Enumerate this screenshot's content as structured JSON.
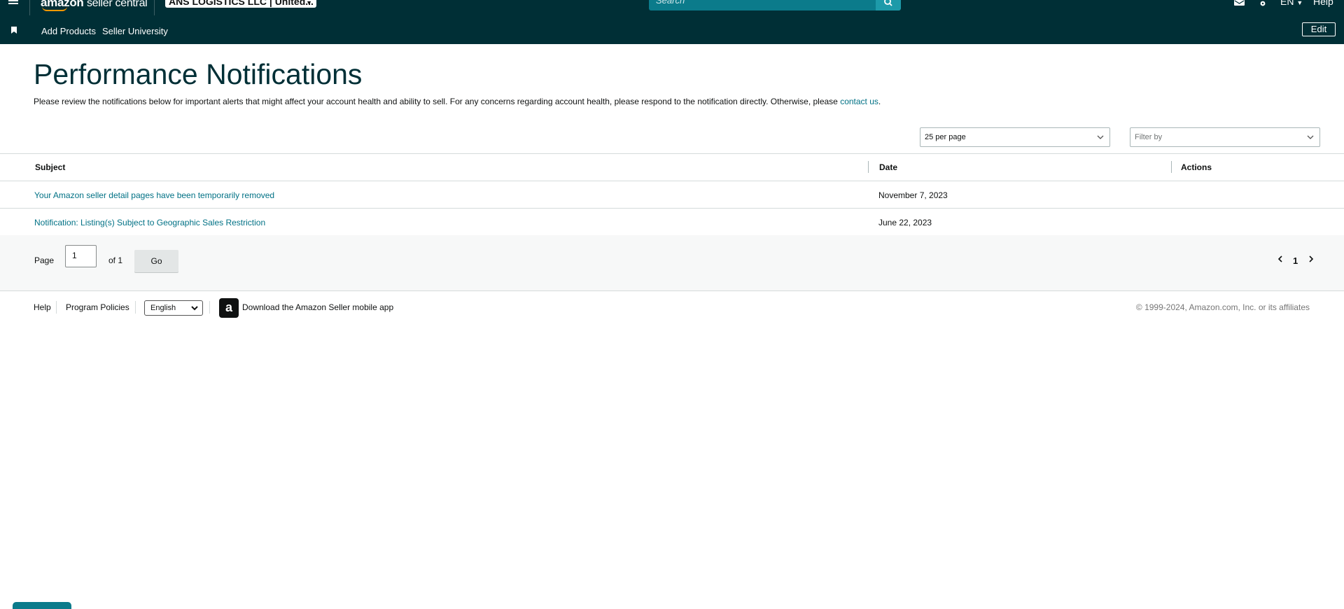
{
  "topnav": {
    "logo_main": "amazon",
    "logo_sub": "seller central",
    "account_label": "ANS LOGISTICS LLC | United...",
    "search_placeholder": "Search",
    "language": "EN",
    "help": "Help"
  },
  "subnav": {
    "links": [
      "Add Products",
      "Seller University"
    ],
    "edit_label": "Edit"
  },
  "page": {
    "title": "Performance Notifications",
    "intro_text": "Please review the notifications below for important alerts that might affect your account health and ability to sell. For any concerns regarding account health, please respond to the notification directly. Otherwise, please ",
    "intro_link": "contact us",
    "intro_end": "."
  },
  "controls": {
    "per_page": "25 per page",
    "filter_placeholder": "Filter by"
  },
  "table": {
    "columns": [
      "Subject",
      "Date",
      "Actions"
    ],
    "rows": [
      {
        "subject": "Your Amazon seller detail pages have been temporarily removed",
        "date": "November 7, 2023",
        "actions": ""
      },
      {
        "subject": "Notification: Listing(s) Subject to Geographic Sales Restriction",
        "date": "June 22, 2023",
        "actions": ""
      }
    ]
  },
  "pager": {
    "page_label": "Page",
    "current_page": "1",
    "of_label": "of 1",
    "go_label": "Go",
    "page_number": "1"
  },
  "footer": {
    "help": "Help",
    "program_policies": "Program Policies",
    "language_select": "English",
    "app_icon_letter": "a",
    "download_app": "Download the Amazon Seller mobile app",
    "copyright": "© 1999-2024, Amazon.com, Inc. or its affiliates"
  },
  "colors": {
    "nav_bg": "#002f36",
    "link": "#007185",
    "search_bg": "#0b7b8b"
  }
}
